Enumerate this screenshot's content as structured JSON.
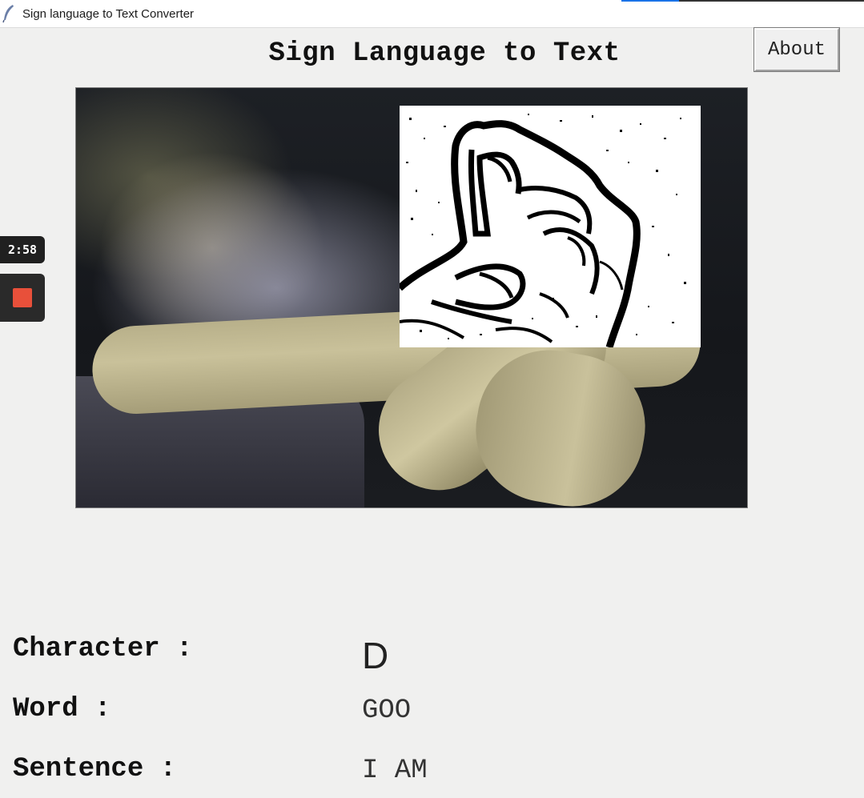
{
  "window": {
    "title": "Sign language to Text Converter",
    "icon": "feather-icon"
  },
  "header": {
    "title": "Sign Language to Text",
    "about_label": "About"
  },
  "camera": {
    "feed_name": "webcam-feed",
    "overlay_name": "thresholded-hand-image"
  },
  "recorder": {
    "time": "2:58",
    "stop_icon": "stop-icon",
    "stop_color": "#e8503a"
  },
  "output": {
    "character_label": "Character :",
    "character_value": "D",
    "word_label": "Word :",
    "word_value": "GOO",
    "sentence_label": "Sentence :",
    "sentence_value": "I AM"
  }
}
